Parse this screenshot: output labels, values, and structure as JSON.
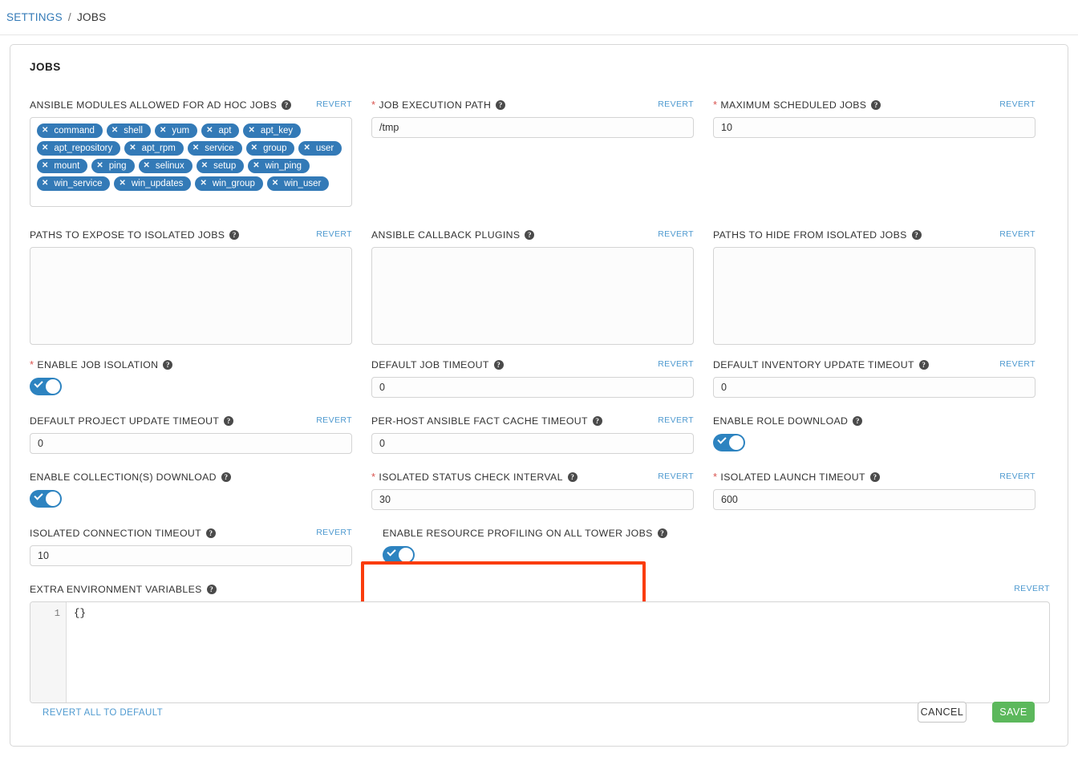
{
  "breadcrumb": {
    "root": "SETTINGS",
    "separator": "/",
    "current": "JOBS"
  },
  "card": {
    "title": "JOBS"
  },
  "common": {
    "revert_label": "REVERT",
    "help_icon": "?"
  },
  "fields": {
    "ansible_modules": {
      "label": "ANSIBLE MODULES ALLOWED FOR AD HOC JOBS",
      "revert": "REVERT",
      "required": false,
      "chips": [
        "command",
        "shell",
        "yum",
        "apt",
        "apt_key",
        "apt_repository",
        "apt_rpm",
        "service",
        "group",
        "user",
        "mount",
        "ping",
        "selinux",
        "setup",
        "win_ping",
        "win_service",
        "win_updates",
        "win_group",
        "win_user"
      ]
    },
    "job_execution_path": {
      "label": "JOB EXECUTION PATH",
      "revert": "REVERT",
      "required": true,
      "value": "/tmp"
    },
    "maximum_scheduled_jobs": {
      "label": "MAXIMUM SCHEDULED JOBS",
      "revert": "REVERT",
      "required": true,
      "value": "10"
    },
    "paths_expose_isolated": {
      "label": "PATHS TO EXPOSE TO ISOLATED JOBS",
      "revert": "REVERT",
      "required": false,
      "value": ""
    },
    "ansible_callback_plugins": {
      "label": "ANSIBLE CALLBACK PLUGINS",
      "revert": "REVERT",
      "required": false,
      "value": ""
    },
    "paths_hide_isolated": {
      "label": "PATHS TO HIDE FROM ISOLATED JOBS",
      "revert": "REVERT",
      "required": false,
      "value": ""
    },
    "enable_job_isolation": {
      "label": "ENABLE JOB ISOLATION",
      "required": true,
      "toggle_state": "on"
    },
    "default_job_timeout": {
      "label": "DEFAULT JOB TIMEOUT",
      "revert": "REVERT",
      "required": false,
      "value": "0"
    },
    "default_inventory_update_timeout": {
      "label": "DEFAULT INVENTORY UPDATE TIMEOUT",
      "revert": "REVERT",
      "required": false,
      "value": "0"
    },
    "default_project_update_timeout": {
      "label": "DEFAULT PROJECT UPDATE TIMEOUT",
      "revert": "REVERT",
      "required": false,
      "value": "0"
    },
    "per_host_fact_cache_timeout": {
      "label": "PER-HOST ANSIBLE FACT CACHE TIMEOUT",
      "revert": "REVERT",
      "required": false,
      "value": "0"
    },
    "enable_role_download": {
      "label": "ENABLE ROLE DOWNLOAD",
      "required": false,
      "toggle_state": "on"
    },
    "enable_collections_download": {
      "label": "ENABLE COLLECTION(S) DOWNLOAD",
      "required": false,
      "toggle_state": "on"
    },
    "isolated_status_check_interval": {
      "label": "ISOLATED STATUS CHECK INTERVAL",
      "revert": "REVERT",
      "required": true,
      "value": "30"
    },
    "isolated_launch_timeout": {
      "label": "ISOLATED LAUNCH TIMEOUT",
      "revert": "REVERT",
      "required": true,
      "value": "600"
    },
    "isolated_connection_timeout": {
      "label": "ISOLATED CONNECTION TIMEOUT",
      "revert": "REVERT",
      "required": false,
      "value": "10"
    },
    "enable_resource_profiling": {
      "label": "ENABLE RESOURCE PROFILING ON ALL TOWER JOBS",
      "required": false,
      "toggle_state": "on",
      "highlighted": true
    },
    "extra_environment_variables": {
      "label": "EXTRA ENVIRONMENT VARIABLES",
      "revert": "REVERT",
      "required": false,
      "line_number": "1",
      "value": "{}"
    }
  },
  "footer": {
    "revert_all_label": "REVERT ALL TO DEFAULT",
    "cancel_label": "CANCEL",
    "save_label": "SAVE"
  },
  "colors": {
    "link_blue": "#337ab7",
    "revert_blue": "#4f9ad0",
    "chip_blue": "#337ab7",
    "toggle_on": "#2d83c0",
    "save_green": "#5cb85c",
    "required_red": "#d9534f",
    "highlight_red": "#fa3c0c"
  }
}
